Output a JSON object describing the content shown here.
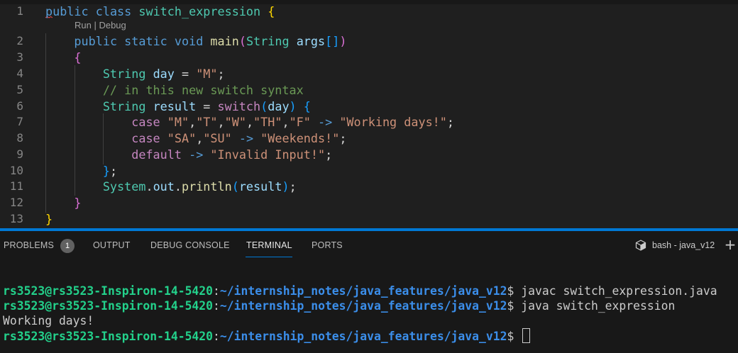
{
  "editor": {
    "codelens": "Run | Debug",
    "lines": [
      {
        "no": "1"
      },
      {
        "no": "2"
      },
      {
        "no": "3"
      },
      {
        "no": "4"
      },
      {
        "no": "5"
      },
      {
        "no": "6"
      },
      {
        "no": "7"
      },
      {
        "no": "8"
      },
      {
        "no": "9"
      },
      {
        "no": "10"
      },
      {
        "no": "11"
      },
      {
        "no": "12"
      },
      {
        "no": "13"
      }
    ],
    "tokens": {
      "public": "public",
      "class": "class",
      "class_name": "switch_expression",
      "static": "static",
      "void": "void",
      "main": "main",
      "String": "String",
      "args": "args",
      "day": "day",
      "str_M": "\"M\"",
      "comment": "// in this new switch syntax",
      "result": "result",
      "switch": "switch",
      "case": "case",
      "str_T": "\"T\"",
      "str_W": "\"W\"",
      "str_TH": "\"TH\"",
      "str_F": "\"F\"",
      "arrow": "->",
      "str_working": "\"Working days!\"",
      "str_SA": "\"SA\"",
      "str_SU": "\"SU\"",
      "str_weekends": "\"Weekends!\"",
      "default": "default",
      "str_invalid": "\"Invalid Input!\"",
      "System": "System",
      "out": "out",
      "println": "println"
    }
  },
  "panel": {
    "tabs": {
      "problems": "PROBLEMS",
      "problems_count": "1",
      "output": "OUTPUT",
      "debug_console": "DEBUG CONSOLE",
      "terminal": "TERMINAL",
      "ports": "PORTS"
    },
    "terminal_name": "bash - java_v12",
    "add_icon": "plus-icon",
    "terminal_icon": "terminal-box-icon"
  },
  "terminal": {
    "user": "rs3523@rs3523-Inspiron-14-5420",
    "path": "~/internship_notes/java_features/java_v12",
    "cmd1": "javac switch_expression.java",
    "cmd2": "java switch_expression",
    "output1": "Working days!"
  },
  "colors": {
    "accent": "#0078d4",
    "prompt_user": "#23d18b",
    "prompt_path": "#3b8eea"
  }
}
